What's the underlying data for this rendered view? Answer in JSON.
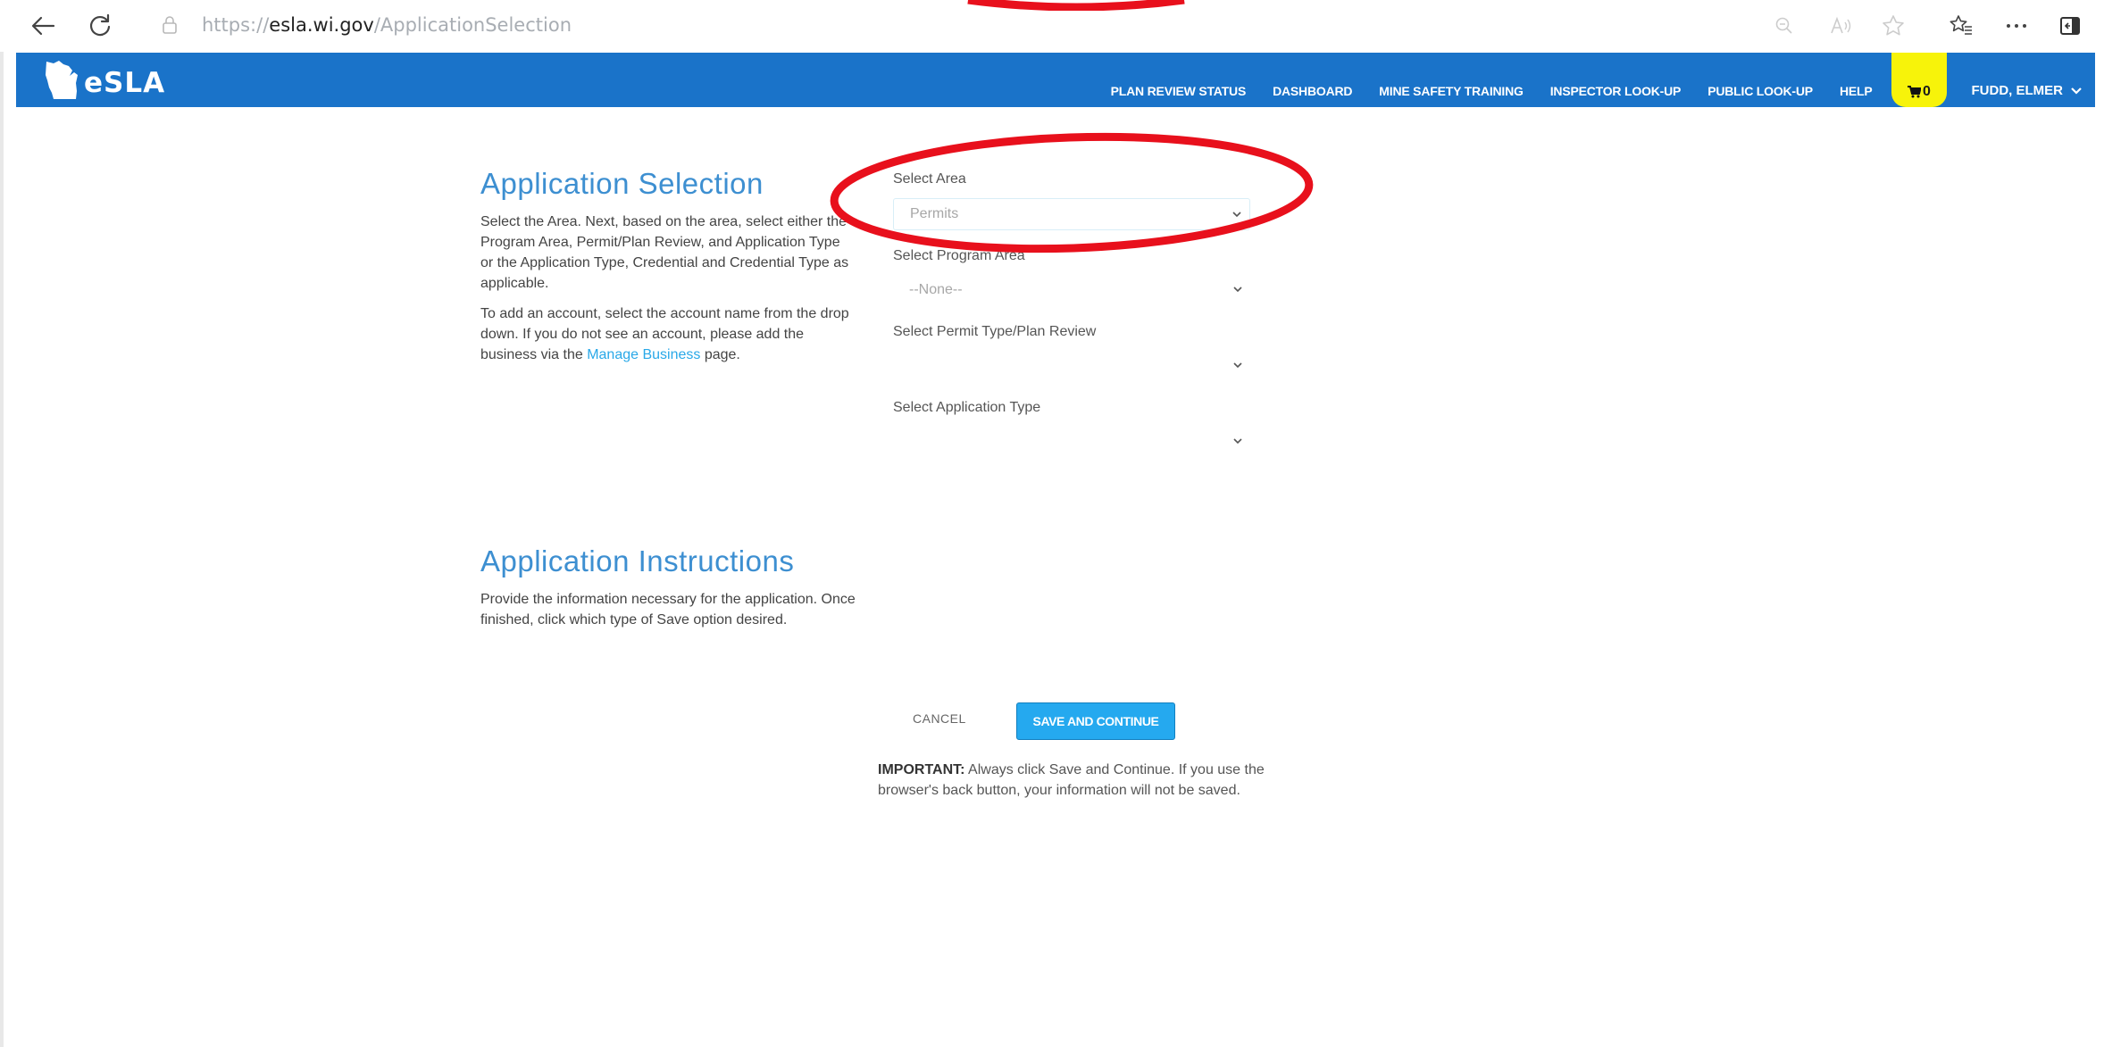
{
  "browser": {
    "url_protocol": "https://",
    "url_host": "esla.wi.gov",
    "url_path": "/ApplicationSelection"
  },
  "header": {
    "logo_text": "eSLA",
    "nav": [
      "PLAN REVIEW STATUS",
      "DASHBOARD",
      "MINE SAFETY TRAINING",
      "INSPECTOR LOOK-UP",
      "PUBLIC LOOK-UP",
      "HELP"
    ],
    "cart_count": "0",
    "user_name": "FUDD, ELMER"
  },
  "selection": {
    "title": "Application Selection",
    "para1": "Select the Area. Next, based on the area, select either the Program Area, Permit/Plan Review, and Application Type or the Application Type, Credential and Credential Type as applicable.",
    "para2_prefix": "To add an account, select the account name from the drop down. If you do not see an account, please add the business via the ",
    "para2_link": "Manage Business",
    "para2_suffix": " page."
  },
  "form": {
    "area_label": "Select Area",
    "area_value": "Permits",
    "program_label": "Select Program Area",
    "program_value": "--None--",
    "permit_label": "Select Permit Type/Plan Review",
    "permit_value": "",
    "apptype_label": "Select Application Type",
    "apptype_value": ""
  },
  "instructions": {
    "title": "Application Instructions",
    "text": "Provide the information necessary for the application. Once finished, click which type of Save option desired."
  },
  "actions": {
    "cancel": "CANCEL",
    "save": "SAVE AND CONTINUE",
    "important_label": "IMPORTANT:",
    "important_text": " Always click Save and Continue. If you use the browser's back button, your information will not be saved."
  },
  "colors": {
    "header_bg": "#1a73c9",
    "cart_bg": "#f7f30a",
    "title": "#3d8fd1",
    "primary_button": "#25a9ef",
    "highlight_ellipse": "#e8101c"
  }
}
